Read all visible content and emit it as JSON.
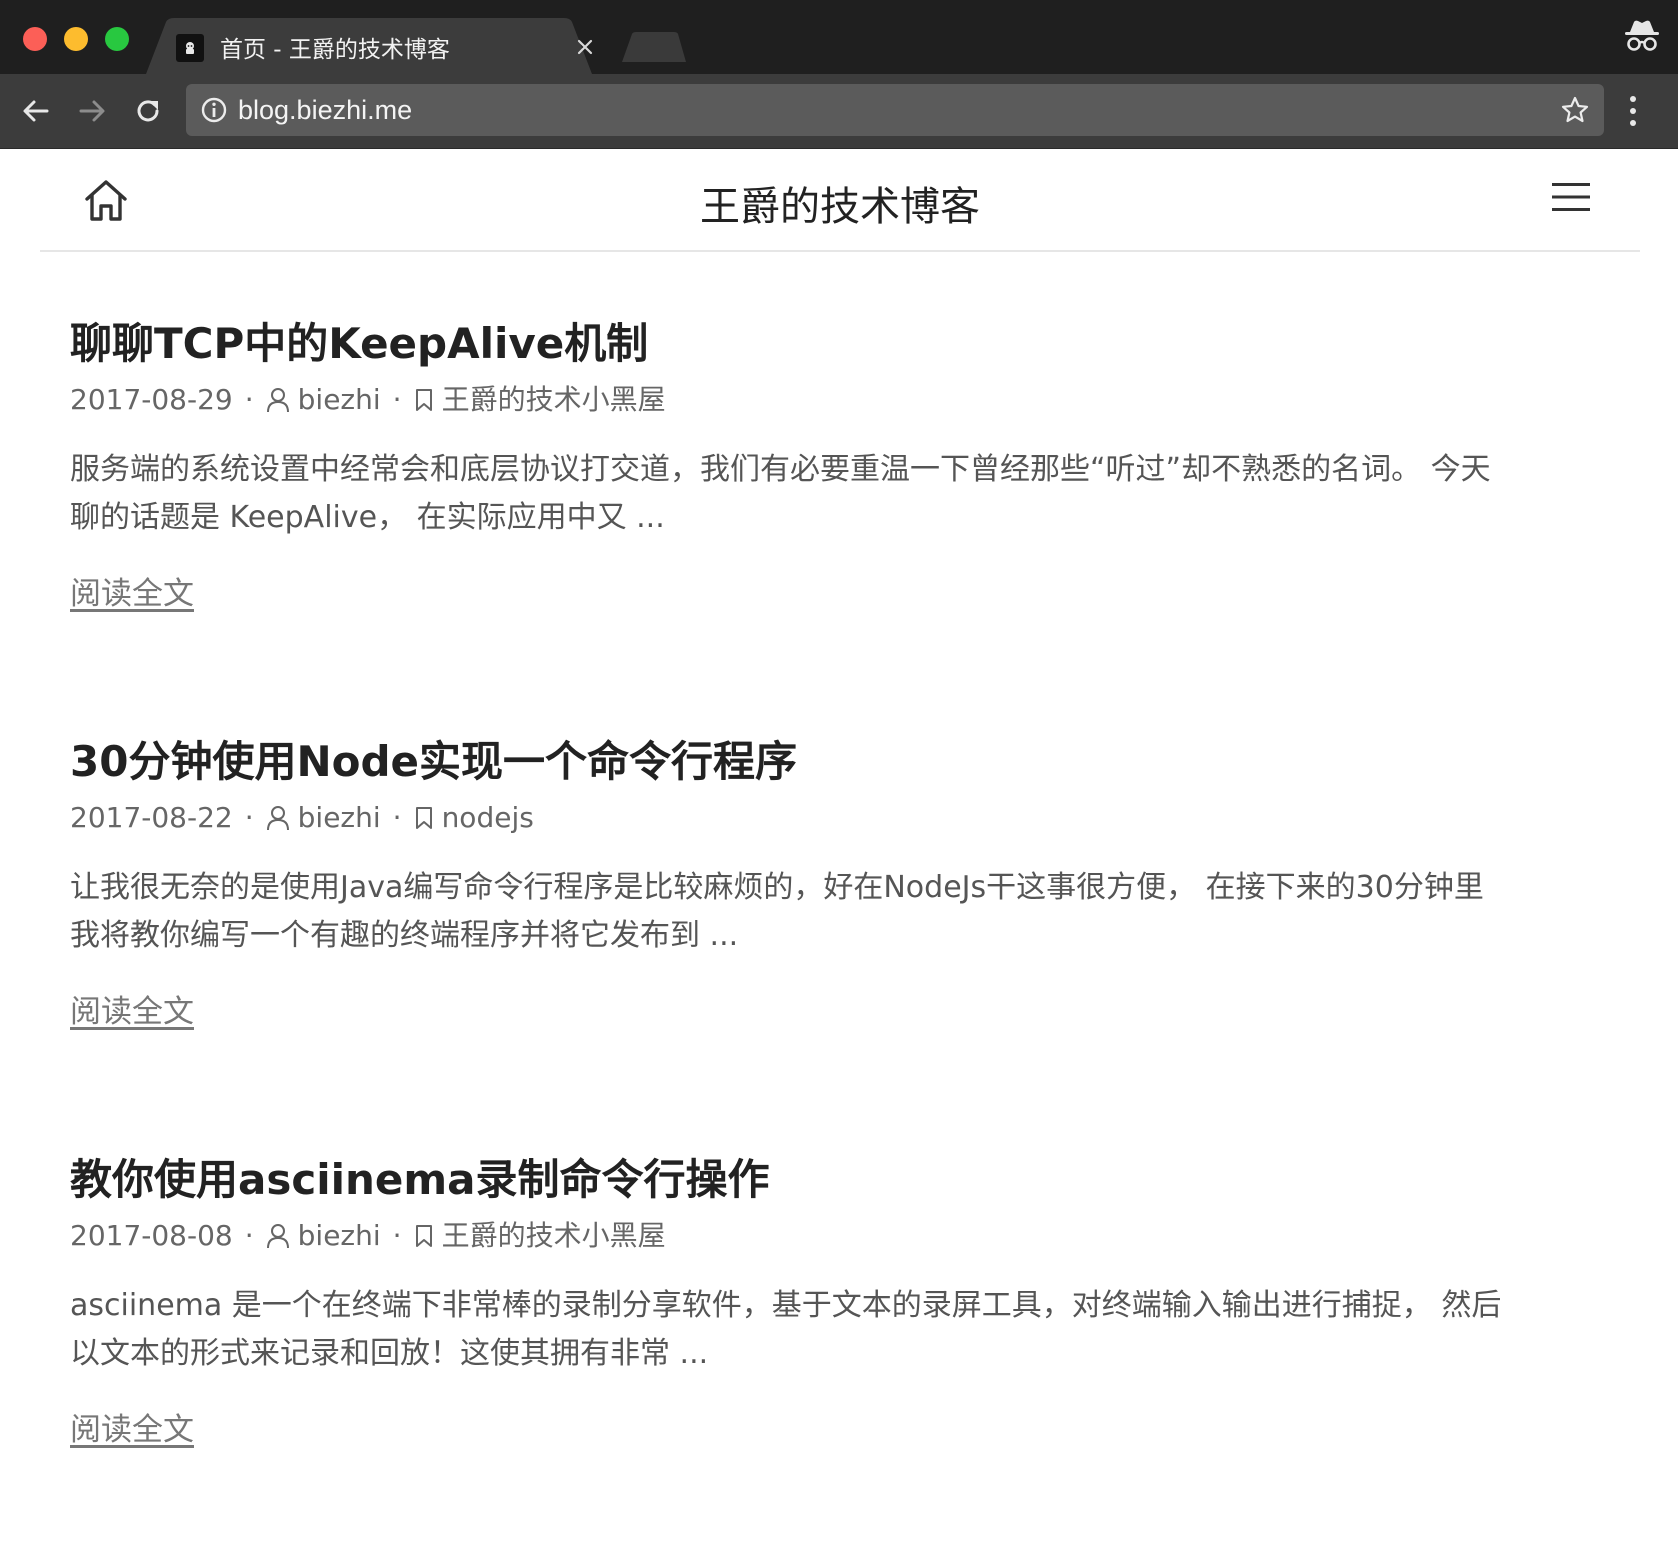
{
  "browser": {
    "tab_title": "首页 - 王爵的技术博客",
    "url": "blog.biezhi.me"
  },
  "site": {
    "title": "王爵的技术博客"
  },
  "posts": [
    {
      "title": "聊聊TCP中的KeepAlive机制",
      "date": "2017-08-29",
      "author": "biezhi",
      "category": "王爵的技术小黑屋",
      "excerpt_line1": "服务端的系统设置中经常会和底层协议打交道，我们有必要重温一下曾经那些“听过”却不熟悉的名词。 今天",
      "excerpt_line2": "聊的话题是 KeepAlive， 在实际应用中又 ...",
      "read_more": "阅读全文"
    },
    {
      "title": "30分钟使用Node实现一个命令行程序",
      "date": "2017-08-22",
      "author": "biezhi",
      "category": "nodejs",
      "excerpt_line1": "让我很无奈的是使用Java编写命令行程序是比较麻烦的，好在NodeJs干这事很方便， 在接下来的30分钟里",
      "excerpt_line2": "我将教你编写一个有趣的终端程序并将它发布到 ...",
      "read_more": "阅读全文"
    },
    {
      "title": "教你使用asciinema录制命令行操作",
      "date": "2017-08-08",
      "author": "biezhi",
      "category": "王爵的技术小黑屋",
      "excerpt_line1": "asciinema 是一个在终端下非常棒的录制分享软件，基于文本的录屏工具，对终端输入输出进行捕捉， 然后",
      "excerpt_line2": "以文本的形式来记录和回放！这使其拥有非常 ...",
      "read_more": "阅读全文"
    }
  ],
  "meta_separator": "·",
  "icons": {
    "home": "home-icon",
    "menu": "hamburger-menu-icon",
    "author": "user-icon",
    "category": "bookmark-icon",
    "incognito": "incognito-icon"
  },
  "colors": {
    "titlebar": "#1f1f1f",
    "toolbar": "#3c3c3c",
    "omnibox": "#5b5b5b",
    "title_text": "#222222",
    "meta_text": "#666666",
    "link": "#777777"
  }
}
